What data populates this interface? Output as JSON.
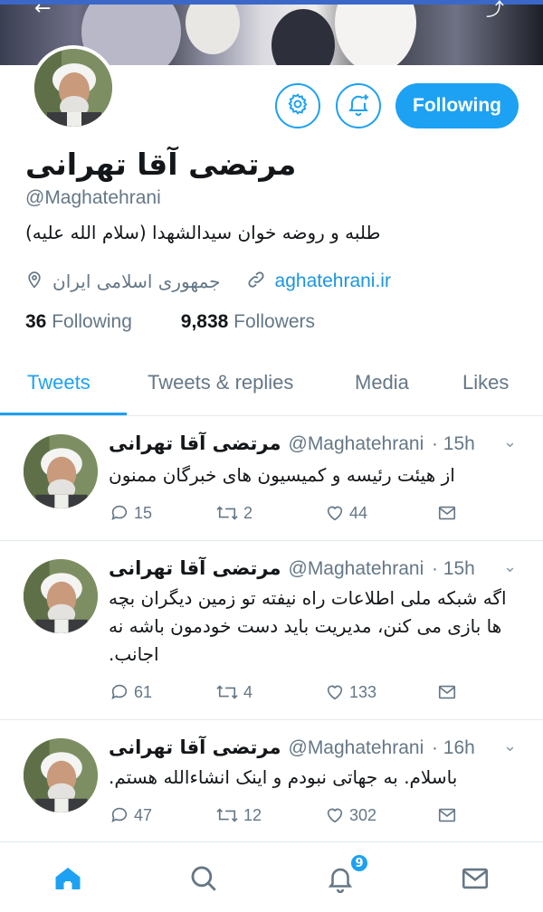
{
  "profile": {
    "name": "مرتضی آقا تهرانی",
    "handle": "@Maghatehrani",
    "bio": "طلبه و روضه خوان سیدالشهدا (سلام الله علیه)",
    "location": "جمهوری اسلامی ایران",
    "website": "aghatehrani.ir",
    "following_count": "36",
    "following_label": "Following",
    "followers_count": "9,838",
    "followers_label": "Followers",
    "follow_button": "Following"
  },
  "icons": {
    "settings": "gear-icon",
    "notify": "bell-plus-icon",
    "location": "map-pin-icon",
    "link": "link-icon"
  },
  "tabs": [
    {
      "label": "Tweets",
      "active": true
    },
    {
      "label": "Tweets & replies",
      "active": false
    },
    {
      "label": "Media",
      "active": false
    },
    {
      "label": "Likes",
      "active": false
    }
  ],
  "tweets": [
    {
      "name": "مرتضی آقا تهرانی",
      "handle": "@Maghatehrani",
      "time": "· 15h",
      "text": "از هیئت رئیسه و کمیسیون های خبرگان ممنون",
      "replies": "15",
      "retweets": "2",
      "likes": "44"
    },
    {
      "name": "مرتضی آقا تهرانی",
      "handle": "@Maghatehrani",
      "time": "· 15h",
      "text": "اگه شبکه ملی اطلاعات راه نیفته تو زمین دیگران بچه ها بازی می کنن، مدیریت باید دست خودمون باشه نه اجانب.",
      "replies": "61",
      "retweets": "4",
      "likes": "133"
    },
    {
      "name": "مرتضی آقا تهرانی",
      "handle": "@Maghatehrani",
      "time": "· 16h",
      "text": "باسلام. به جهاتی نبودم و اینک انشاءالله هستم.",
      "replies": "47",
      "retweets": "12",
      "likes": "302"
    }
  ],
  "nav": {
    "notifications_badge": "9",
    "accent_color": "#1da1f2"
  }
}
